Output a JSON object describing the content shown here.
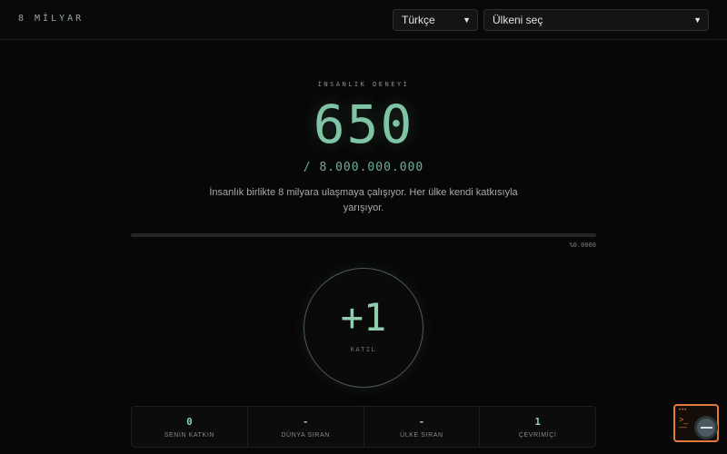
{
  "header": {
    "logo": "8 MİLYAR",
    "language_select": "Türkçe",
    "country_select": "Ülkeni seç"
  },
  "hero": {
    "eyebrow": "İNSANLIK DENEYİ",
    "counter": "650",
    "total": "/ 8.000.000.000",
    "description": "İnsanlık birlikte 8 milyara ulaşmaya çalışıyor. Her ülke kendi katkısıyla yarışıyor.",
    "progress_percent": 0.0,
    "progress_label": "%0.0000"
  },
  "join": {
    "plus": "+1",
    "label": "KATIL"
  },
  "stats": [
    {
      "value": "0",
      "label": "SENİN KATKIN"
    },
    {
      "value": "-",
      "label": "DÜNYA SIRAN"
    },
    {
      "value": "-",
      "label": "ÜLKE SIRAN"
    },
    {
      "value": "1",
      "label": "ÇEVRİMİÇİ"
    }
  ],
  "colors": {
    "accent": "#7fc4a4",
    "background": "#070707",
    "widget": "#e07a3a"
  },
  "icons": {
    "select_chevron": "chevron-down-icon",
    "widget": "terminal-search-icon"
  }
}
